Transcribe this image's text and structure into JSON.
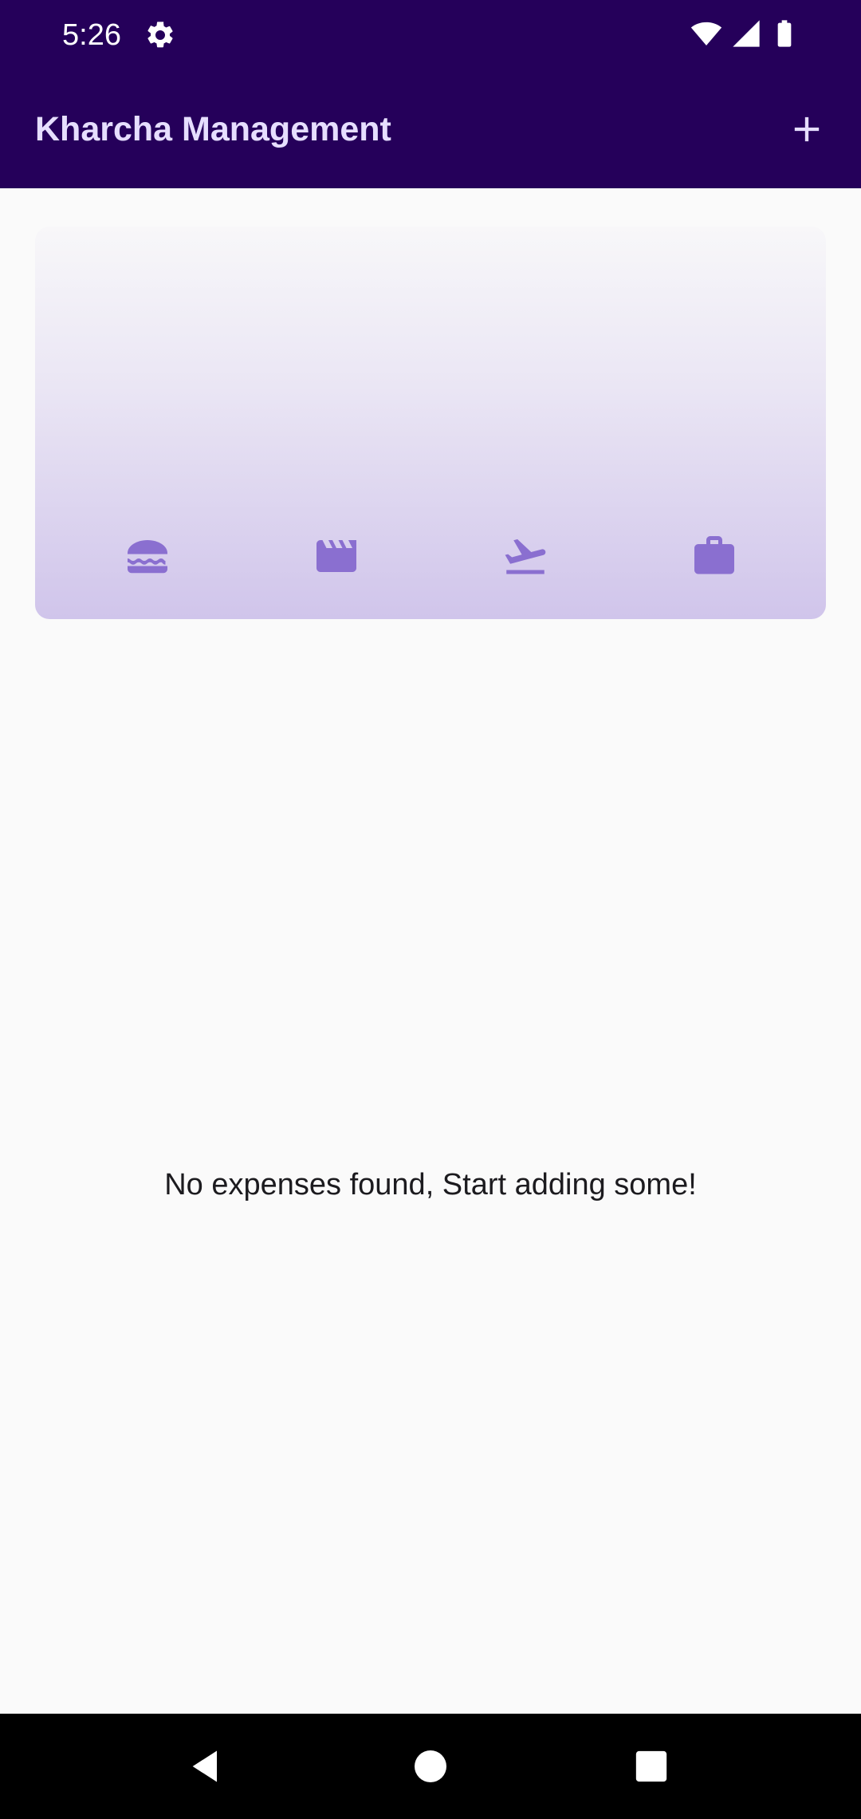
{
  "status_bar": {
    "time": "5:26",
    "icons": [
      "settings-gear-icon",
      "wifi-icon",
      "cellular-signal-icon",
      "battery-icon"
    ]
  },
  "app_bar": {
    "title": "Kharcha Management",
    "action_icon": "add-icon"
  },
  "chart_card": {
    "categories": [
      {
        "icon": "food-burger-icon"
      },
      {
        "icon": "movie-clapper-icon"
      },
      {
        "icon": "flight-takeoff-icon"
      },
      {
        "icon": "work-briefcase-icon"
      }
    ],
    "accent_color": "#8A6FD0"
  },
  "main": {
    "empty_message": "No expenses found, Start adding some!"
  },
  "nav_bar": {
    "buttons": [
      "back-icon",
      "home-icon",
      "recents-icon"
    ]
  },
  "colors": {
    "primary": "#25005A",
    "title_text": "#E6DEFF",
    "background": "#FAFAFA",
    "category_icon": "#8A6FD0"
  }
}
